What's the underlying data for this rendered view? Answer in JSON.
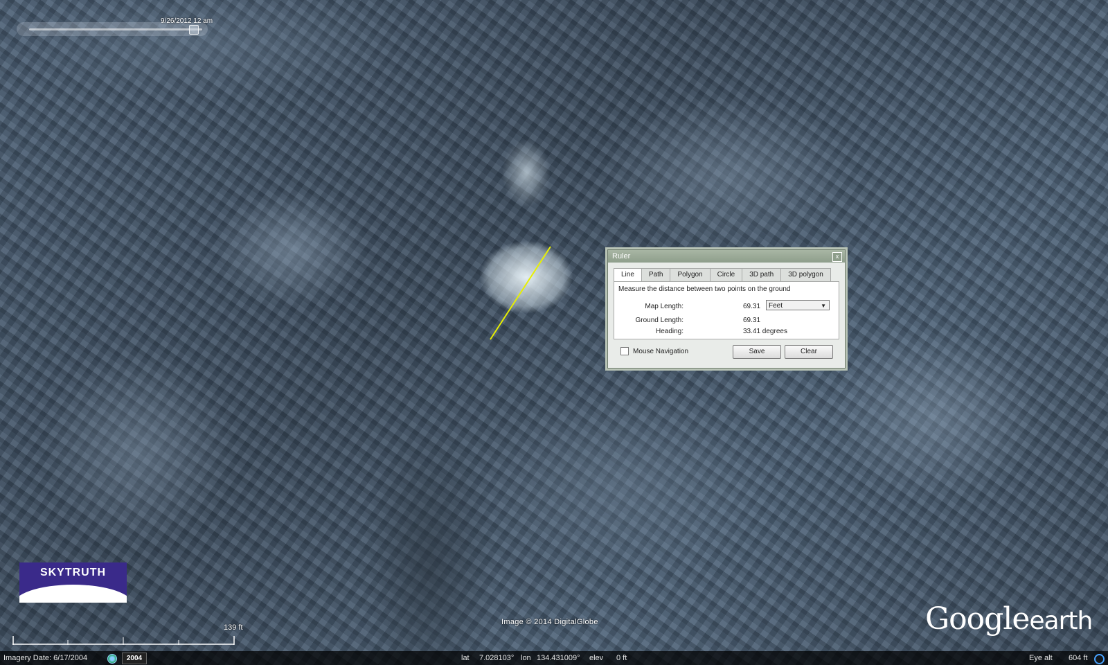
{
  "time_slider": {
    "date_label": "9/26/2012  12 am"
  },
  "ruler": {
    "title": "Ruler",
    "close_icon": "x",
    "tabs": [
      "Line",
      "Path",
      "Polygon",
      "Circle",
      "3D path",
      "3D polygon"
    ],
    "active_tab": "Line",
    "description": "Measure the distance between two points on the ground",
    "map_length_label": "Map Length:",
    "map_length_value": "69.31",
    "units_selected": "Feet",
    "ground_length_label": "Ground Length:",
    "ground_length_value": "69.31",
    "heading_label": "Heading:",
    "heading_value": "33.41 degrees",
    "mouse_navigation_label": "Mouse Navigation",
    "save_label": "Save",
    "clear_label": "Clear"
  },
  "logo": {
    "text": "SKYTRUTH"
  },
  "scale": {
    "label": "139 ft"
  },
  "copyright": "Image © 2014 DigitalGlobe",
  "brand": {
    "google": "Google",
    "earth": "earth"
  },
  "status_bar": {
    "imagery_date": "Imagery Date: 6/17/2004",
    "year": "2004",
    "lat_label": "lat",
    "lat": "7.028103°",
    "lon_label": "lon",
    "lon": "134.431009°",
    "elev_label": "elev",
    "elev": "0 ft",
    "eye_alt_label": "Eye alt",
    "eye_alt": "604 ft"
  },
  "colors": {
    "measure_line": "#e8f000",
    "logo_bg": "#3a2a8a"
  }
}
